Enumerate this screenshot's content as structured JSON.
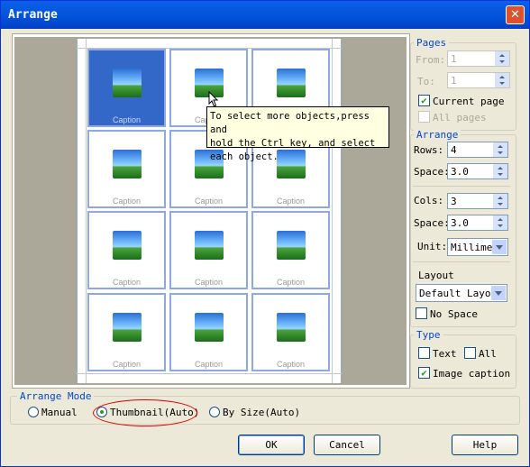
{
  "window": {
    "title": "Arrange",
    "close": "✕"
  },
  "preview": {
    "caption": "Caption",
    "tooltip": [
      "To select more objects,press and",
      "hold the Ctrl key, and select",
      "each object."
    ]
  },
  "pages": {
    "title": "Pages",
    "from_label": "From:",
    "from_value": "1",
    "to_label": "To:",
    "to_value": "1",
    "current_page_label": "Current page",
    "current_page_checked": true,
    "all_pages_label": "All pages",
    "all_pages_checked": false
  },
  "arrange": {
    "title": "Arrange",
    "rows_label": "Rows:",
    "rows_value": "4",
    "row_space_label": "Space:",
    "row_space_value": "3.0",
    "cols_label": "Cols:",
    "cols_value": "3",
    "col_space_label": "Space:",
    "col_space_value": "3.0",
    "unit_label": "Unit:",
    "unit_value": "Millime",
    "layout_label": "Layout",
    "layout_value": "Default Layou",
    "no_space_label": "No Space",
    "no_space_checked": false
  },
  "type": {
    "title": "Type",
    "text_label": "Text",
    "text_checked": false,
    "all_label": "All",
    "all_checked": false,
    "image_caption_label": "Image caption",
    "image_caption_checked": true
  },
  "arrange_mode": {
    "title": "Arrange Mode",
    "manual": "Manual",
    "thumbnail": "Thumbnail(Auto)",
    "by_size": "By Size(Auto)",
    "selected": "thumbnail"
  },
  "buttons": {
    "ok": "OK",
    "cancel": "Cancel",
    "help": "Help"
  },
  "colors": {
    "title_bar": "#0455dc",
    "selected_cell": "#3468c8",
    "cell_border": "#8ea7e6",
    "tooltip_bg": "#ffffe1",
    "highlight_ellipse": "#e00000"
  }
}
